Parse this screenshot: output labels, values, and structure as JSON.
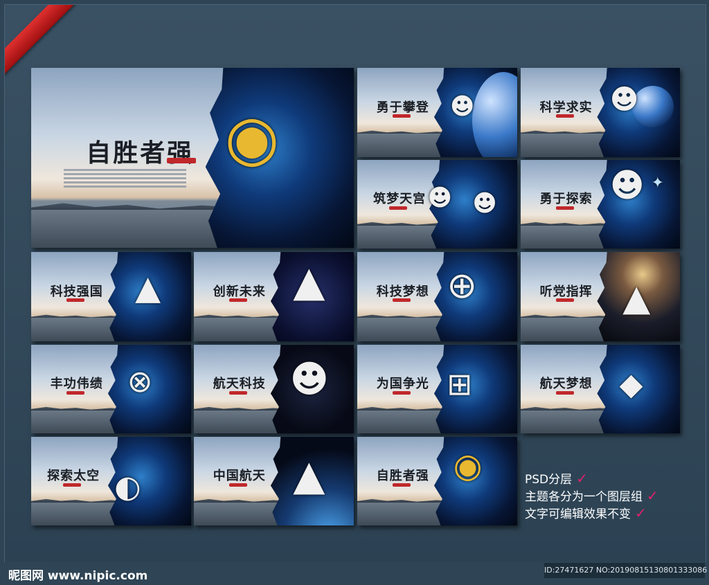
{
  "cards": [
    {
      "title": "自胜者强",
      "big": true
    },
    {
      "title": "勇于攀登"
    },
    {
      "title": "科学求实"
    },
    {
      "title": "筑梦天宫"
    },
    {
      "title": "勇于探索"
    },
    {
      "title": "科技强国"
    },
    {
      "title": "创新未来"
    },
    {
      "title": "科技梦想"
    },
    {
      "title": "听党指挥"
    },
    {
      "title": "丰功伟绩"
    },
    {
      "title": "航天科技"
    },
    {
      "title": "为国争光"
    },
    {
      "title": "航天梦想"
    },
    {
      "title": "探索太空"
    },
    {
      "title": "中国航天"
    },
    {
      "title": "自胜者强"
    }
  ],
  "features": [
    {
      "text": "PSD分层"
    },
    {
      "text": "主题各分为一个图层组"
    },
    {
      "text": "文字可编辑效果不变"
    }
  ],
  "watermark": {
    "site": "昵图网 www.nipic.com",
    "id": "ID:27471627 NO:20190815130801333086"
  },
  "colors": {
    "accent": "#c0282b",
    "check": "#e2206c",
    "background": "#2f4556"
  }
}
